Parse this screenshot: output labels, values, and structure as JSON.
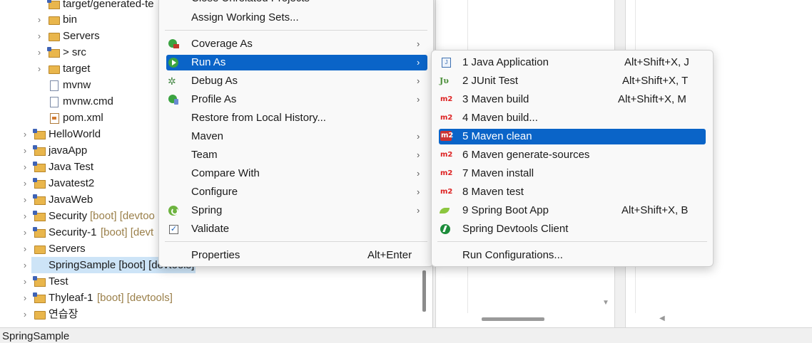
{
  "explorer": {
    "rows": [
      {
        "label": "target/generated-te",
        "deco": ""
      },
      {
        "label": "bin",
        "deco": ""
      },
      {
        "label": "Servers",
        "deco": ""
      },
      {
        "label": "> src",
        "deco": ""
      },
      {
        "label": "target",
        "deco": ""
      },
      {
        "label": "mvnw",
        "deco": ""
      },
      {
        "label": "mvnw.cmd",
        "deco": ""
      },
      {
        "label": "pom.xml",
        "deco": ""
      },
      {
        "label": "HelloWorld",
        "deco": ""
      },
      {
        "label": "javaApp",
        "deco": ""
      },
      {
        "label": "Java Test",
        "deco": ""
      },
      {
        "label": "Javatest2",
        "deco": ""
      },
      {
        "label": "JavaWeb",
        "deco": ""
      },
      {
        "label": "Security",
        "deco": "[boot] [devtoo"
      },
      {
        "label": "Security-1",
        "deco": "[boot] [devt"
      },
      {
        "label": "Servers",
        "deco": ""
      },
      {
        "label": "SpringSample [boot] [devtools]",
        "deco": ""
      },
      {
        "label": "Test",
        "deco": ""
      },
      {
        "label": "Thyleaf-1",
        "deco": "[boot] [devtools]"
      },
      {
        "label": "연습장",
        "deco": ""
      }
    ]
  },
  "context_menu": {
    "items": [
      {
        "label": "Close Unrelated Projects",
        "accel": "",
        "submenu": false,
        "icon": ""
      },
      {
        "label": "Assign Working Sets...",
        "accel": "",
        "submenu": false,
        "icon": ""
      },
      {
        "label": "Coverage As",
        "accel": "",
        "submenu": true,
        "icon": "coverage-icon"
      },
      {
        "label": "Run As",
        "accel": "",
        "submenu": true,
        "icon": "run-icon"
      },
      {
        "label": "Debug As",
        "accel": "",
        "submenu": true,
        "icon": "debug-icon"
      },
      {
        "label": "Profile As",
        "accel": "",
        "submenu": true,
        "icon": "profile-icon"
      },
      {
        "label": "Restore from Local History...",
        "accel": "",
        "submenu": false,
        "icon": ""
      },
      {
        "label": "Maven",
        "accel": "",
        "submenu": true,
        "icon": ""
      },
      {
        "label": "Team",
        "accel": "",
        "submenu": true,
        "icon": ""
      },
      {
        "label": "Compare With",
        "accel": "",
        "submenu": true,
        "icon": ""
      },
      {
        "label": "Configure",
        "accel": "",
        "submenu": true,
        "icon": ""
      },
      {
        "label": "Spring",
        "accel": "",
        "submenu": true,
        "icon": "spring-icon"
      },
      {
        "label": "Validate",
        "accel": "",
        "submenu": false,
        "icon": "checkbox-icon"
      },
      {
        "label": "Properties",
        "accel": "Alt+Enter",
        "submenu": false,
        "icon": ""
      }
    ]
  },
  "run_as_submenu": {
    "items": [
      {
        "label": "1 Java Application",
        "accel": "Alt+Shift+X, J",
        "icon": "java-application-icon"
      },
      {
        "label": "2 JUnit Test",
        "accel": "Alt+Shift+X, T",
        "icon": "junit-icon"
      },
      {
        "label": "3 Maven build",
        "accel": "Alt+Shift+X, M",
        "icon": "maven-icon"
      },
      {
        "label": "4 Maven build...",
        "accel": "",
        "icon": "maven-icon"
      },
      {
        "label": "5 Maven clean",
        "accel": "",
        "icon": "maven-icon"
      },
      {
        "label": "6 Maven generate-sources",
        "accel": "",
        "icon": "maven-icon"
      },
      {
        "label": "7 Maven install",
        "accel": "",
        "icon": "maven-icon"
      },
      {
        "label": "8 Maven test",
        "accel": "",
        "icon": "maven-icon"
      },
      {
        "label": "9 Spring Boot App",
        "accel": "Alt+Shift+X, B",
        "icon": "spring-boot-icon"
      },
      {
        "label": "Spring Devtools Client",
        "accel": "",
        "icon": "devtools-icon"
      },
      {
        "label": "Run Configurations...",
        "accel": "",
        "icon": ""
      }
    ],
    "maven_icon_text": "m2"
  },
  "statusbar": {
    "text": "SpringSample"
  },
  "colors": {
    "highlight": "#0a64c8",
    "selection": "#cde4f7",
    "decoration": "#9a7f49"
  }
}
